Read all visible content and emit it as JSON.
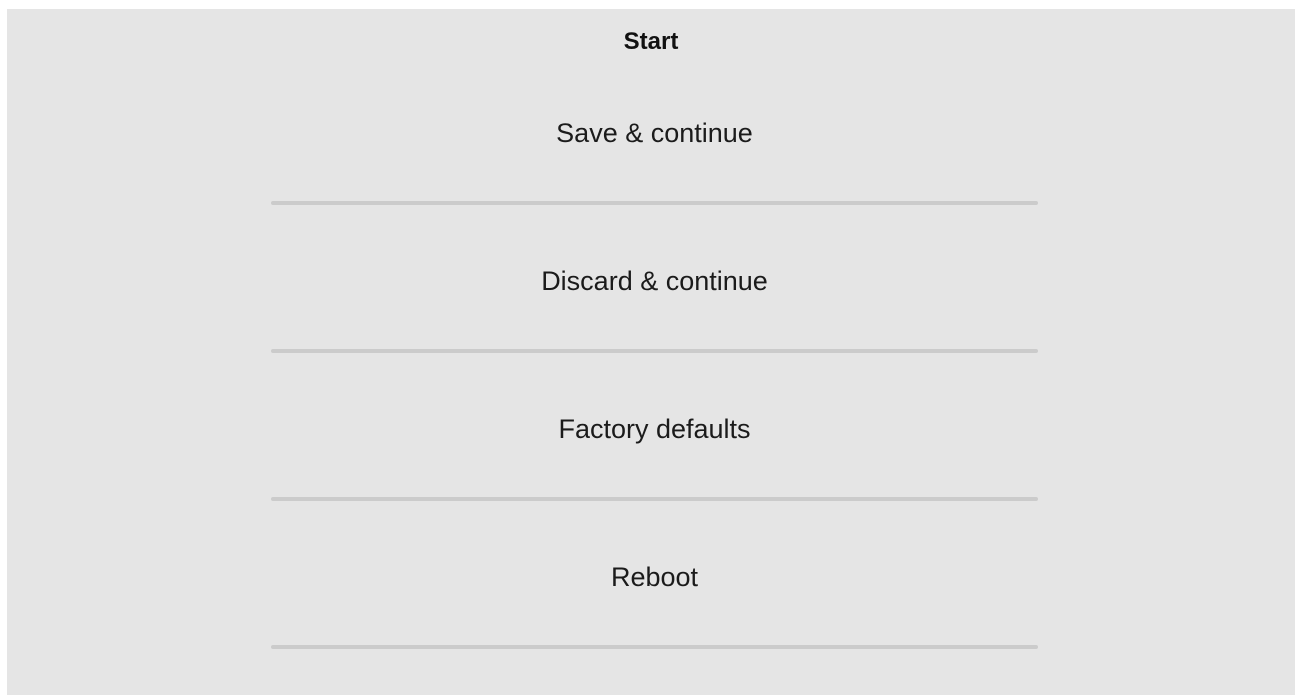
{
  "dialog": {
    "title": "Start",
    "items": [
      {
        "label": "Save & continue"
      },
      {
        "label": "Discard & continue"
      },
      {
        "label": "Factory defaults"
      },
      {
        "label": "Reboot"
      }
    ]
  }
}
